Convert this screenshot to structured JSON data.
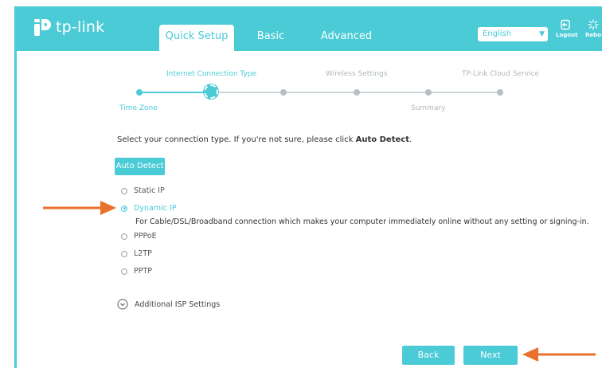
{
  "brand": {
    "logo_text": "tp-link",
    "accent": "#4acbd6",
    "arrow_color": "#e8722c"
  },
  "tabs": [
    {
      "label": "Quick Setup",
      "active": true
    },
    {
      "label": "Basic",
      "active": false
    },
    {
      "label": "Advanced",
      "active": false
    }
  ],
  "header": {
    "language": "English",
    "logout_label": "Logout",
    "reboot_label": "Rebo"
  },
  "steps": {
    "top": [
      "Internet Connection Type",
      "Wireless Settings",
      "TP-Link Cloud Service"
    ],
    "bottom": [
      "Time Zone",
      "Summary"
    ]
  },
  "main": {
    "instruction_prefix": "Select your connection type. If you're not sure, please click ",
    "instruction_bold": "Auto Detect",
    "instruction_suffix": ".",
    "auto_detect_label": "Auto Detect",
    "options": [
      {
        "label": "Static IP",
        "selected": false
      },
      {
        "label": "Dynamic IP",
        "selected": true
      },
      {
        "label": "PPPoE",
        "selected": false
      },
      {
        "label": "L2TP",
        "selected": false
      },
      {
        "label": "PPTP",
        "selected": false
      }
    ],
    "dynamic_description": "For Cable/DSL/Broadband connection which makes your computer immediately online without any setting or signing-in.",
    "additional_label": "Additional ISP Settings"
  },
  "footer": {
    "back_label": "Back",
    "next_label": "Next"
  },
  "icons": [
    "tp-link-logo-icon",
    "chevron-down-icon",
    "logout-icon",
    "reboot-icon",
    "chevron-down-circle-icon",
    "annotation-arrow-icon"
  ]
}
